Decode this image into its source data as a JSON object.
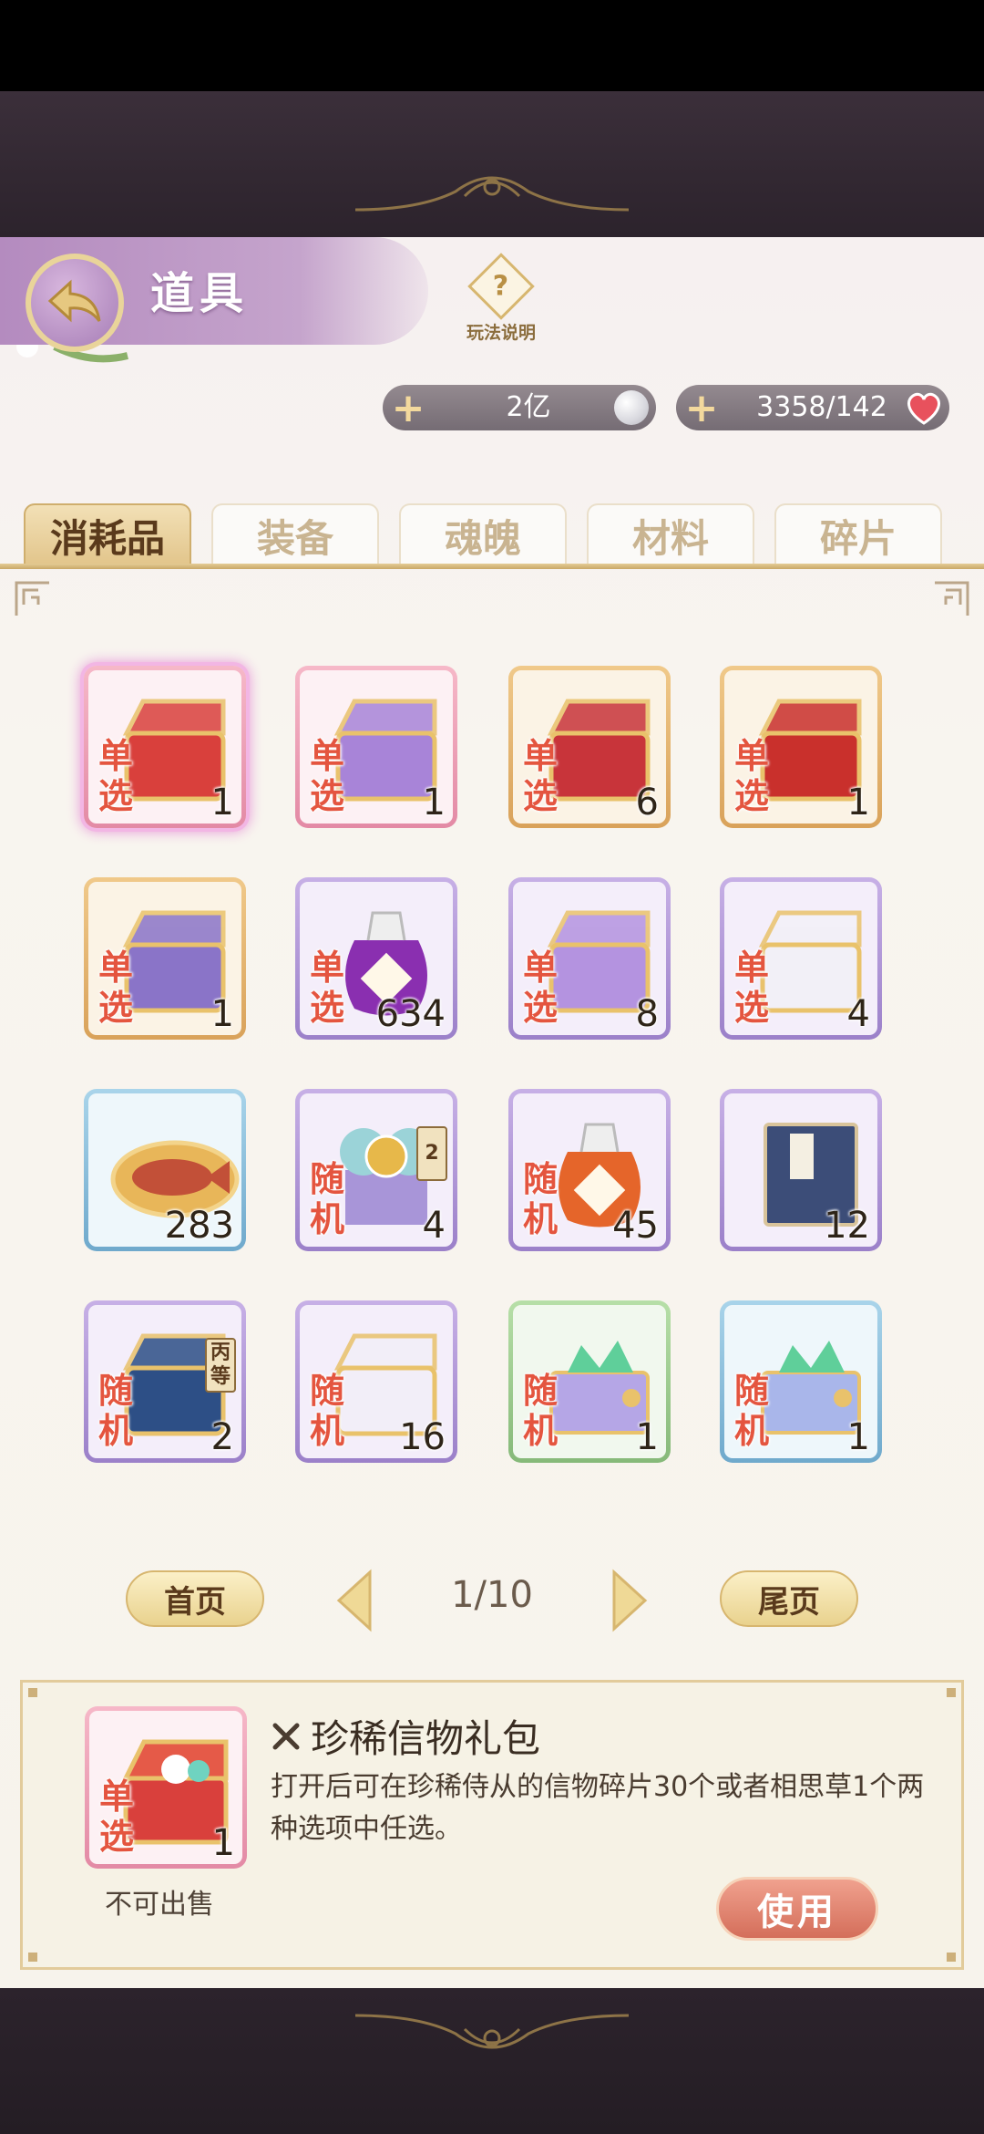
{
  "header": {
    "title": "道具",
    "help_label": "玩法说明",
    "help_glyph": "?"
  },
  "currencies": {
    "silver": {
      "value": "2亿",
      "add_glyph": "+"
    },
    "heart": {
      "value": "3358/142",
      "add_glyph": "+"
    }
  },
  "tabs": [
    {
      "label": "消耗品",
      "active": true
    },
    {
      "label": "装备",
      "active": false
    },
    {
      "label": "魂魄",
      "active": false
    },
    {
      "label": "材料",
      "active": false
    },
    {
      "label": "碎片",
      "active": false
    }
  ],
  "items": [
    {
      "tag": "单选",
      "count": "1",
      "rarity": "pink",
      "icon": "red-treasure-chest-icon",
      "selected": true
    },
    {
      "tag": "单选",
      "count": "1",
      "rarity": "pink",
      "icon": "purple-treasure-chest-icon",
      "selected": false
    },
    {
      "tag": "单选",
      "count": "6",
      "rarity": "orange",
      "icon": "red-scroll-box-icon",
      "selected": false
    },
    {
      "tag": "单选",
      "count": "1",
      "rarity": "orange",
      "icon": "red-gold-chest-icon",
      "selected": false
    },
    {
      "tag": "单选",
      "count": "1",
      "rarity": "orange",
      "icon": "purple-locked-chest-icon",
      "selected": false
    },
    {
      "tag": "单选",
      "count": "634",
      "rarity": "purple",
      "icon": "purple-fragment-pouch-icon",
      "selected": false
    },
    {
      "tag": "单选",
      "count": "8",
      "rarity": "purple",
      "icon": "purple-chest-icon",
      "selected": false
    },
    {
      "tag": "单选",
      "count": "4",
      "rarity": "purple",
      "icon": "purple-gift-box-icon",
      "selected": false
    },
    {
      "tag": "",
      "count": "283",
      "rarity": "blue",
      "icon": "fish-plate-icon",
      "selected": false
    },
    {
      "tag": "随机",
      "count": "4",
      "rarity": "purple",
      "icon": "blue-gift-bow-icon",
      "badge": "2",
      "selected": false
    },
    {
      "tag": "随机",
      "count": "45",
      "rarity": "purple",
      "icon": "orange-fragment-pouch-icon",
      "selected": false
    },
    {
      "tag": "",
      "count": "12",
      "rarity": "purple",
      "icon": "blue-book-icon",
      "selected": false
    },
    {
      "tag": "随机",
      "count": "2",
      "rarity": "purple",
      "icon": "blue-gold-chest-icon",
      "badge": "丙等",
      "selected": false
    },
    {
      "tag": "随机",
      "count": "16",
      "rarity": "purple",
      "icon": "white-chest-icon",
      "selected": false
    },
    {
      "tag": "随机",
      "count": "1",
      "rarity": "green",
      "icon": "gem-jewelry-box-icon",
      "selected": false
    },
    {
      "tag": "随机",
      "count": "1",
      "rarity": "blue",
      "icon": "gem-jewelry-box-blue-icon",
      "selected": false
    }
  ],
  "pagination": {
    "first_label": "首页",
    "last_label": "尾页",
    "indicator": "1/10",
    "current": 1,
    "total": 10
  },
  "detail": {
    "tag": "单选",
    "count": "1",
    "name": "珍稀信物礼包",
    "description": "打开后可在珍稀侍从的信物碎片30个或者相思草1个两种选项中任选。",
    "sell_status": "不可出售",
    "use_label": "使用"
  },
  "colors": {
    "tag_red": "#e4553f",
    "gold": "#d7b66f",
    "title_purple": "#b48bbf",
    "use_button": "#d46e5a"
  }
}
